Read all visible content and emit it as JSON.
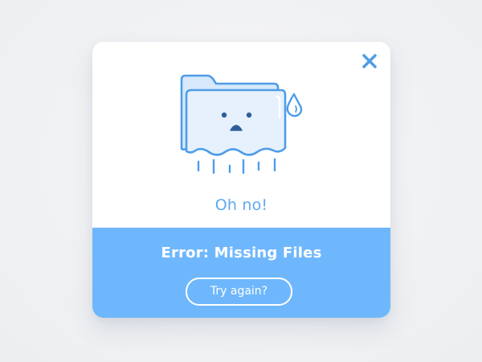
{
  "dialog": {
    "message": "Oh no!",
    "error_title": "Error: Missing Files",
    "retry_label": "Try again?",
    "close_icon": "close-icon",
    "illustration_icon": "sad-melting-folder-icon"
  },
  "colors": {
    "accent": "#6fb7fc",
    "text_blue": "#5eaaf1",
    "folder_fill": "#d7e9fb",
    "folder_fill_front": "#e6f1fd",
    "outline": "#4f9de8",
    "background": "#f1f2f4",
    "white": "#ffffff"
  }
}
